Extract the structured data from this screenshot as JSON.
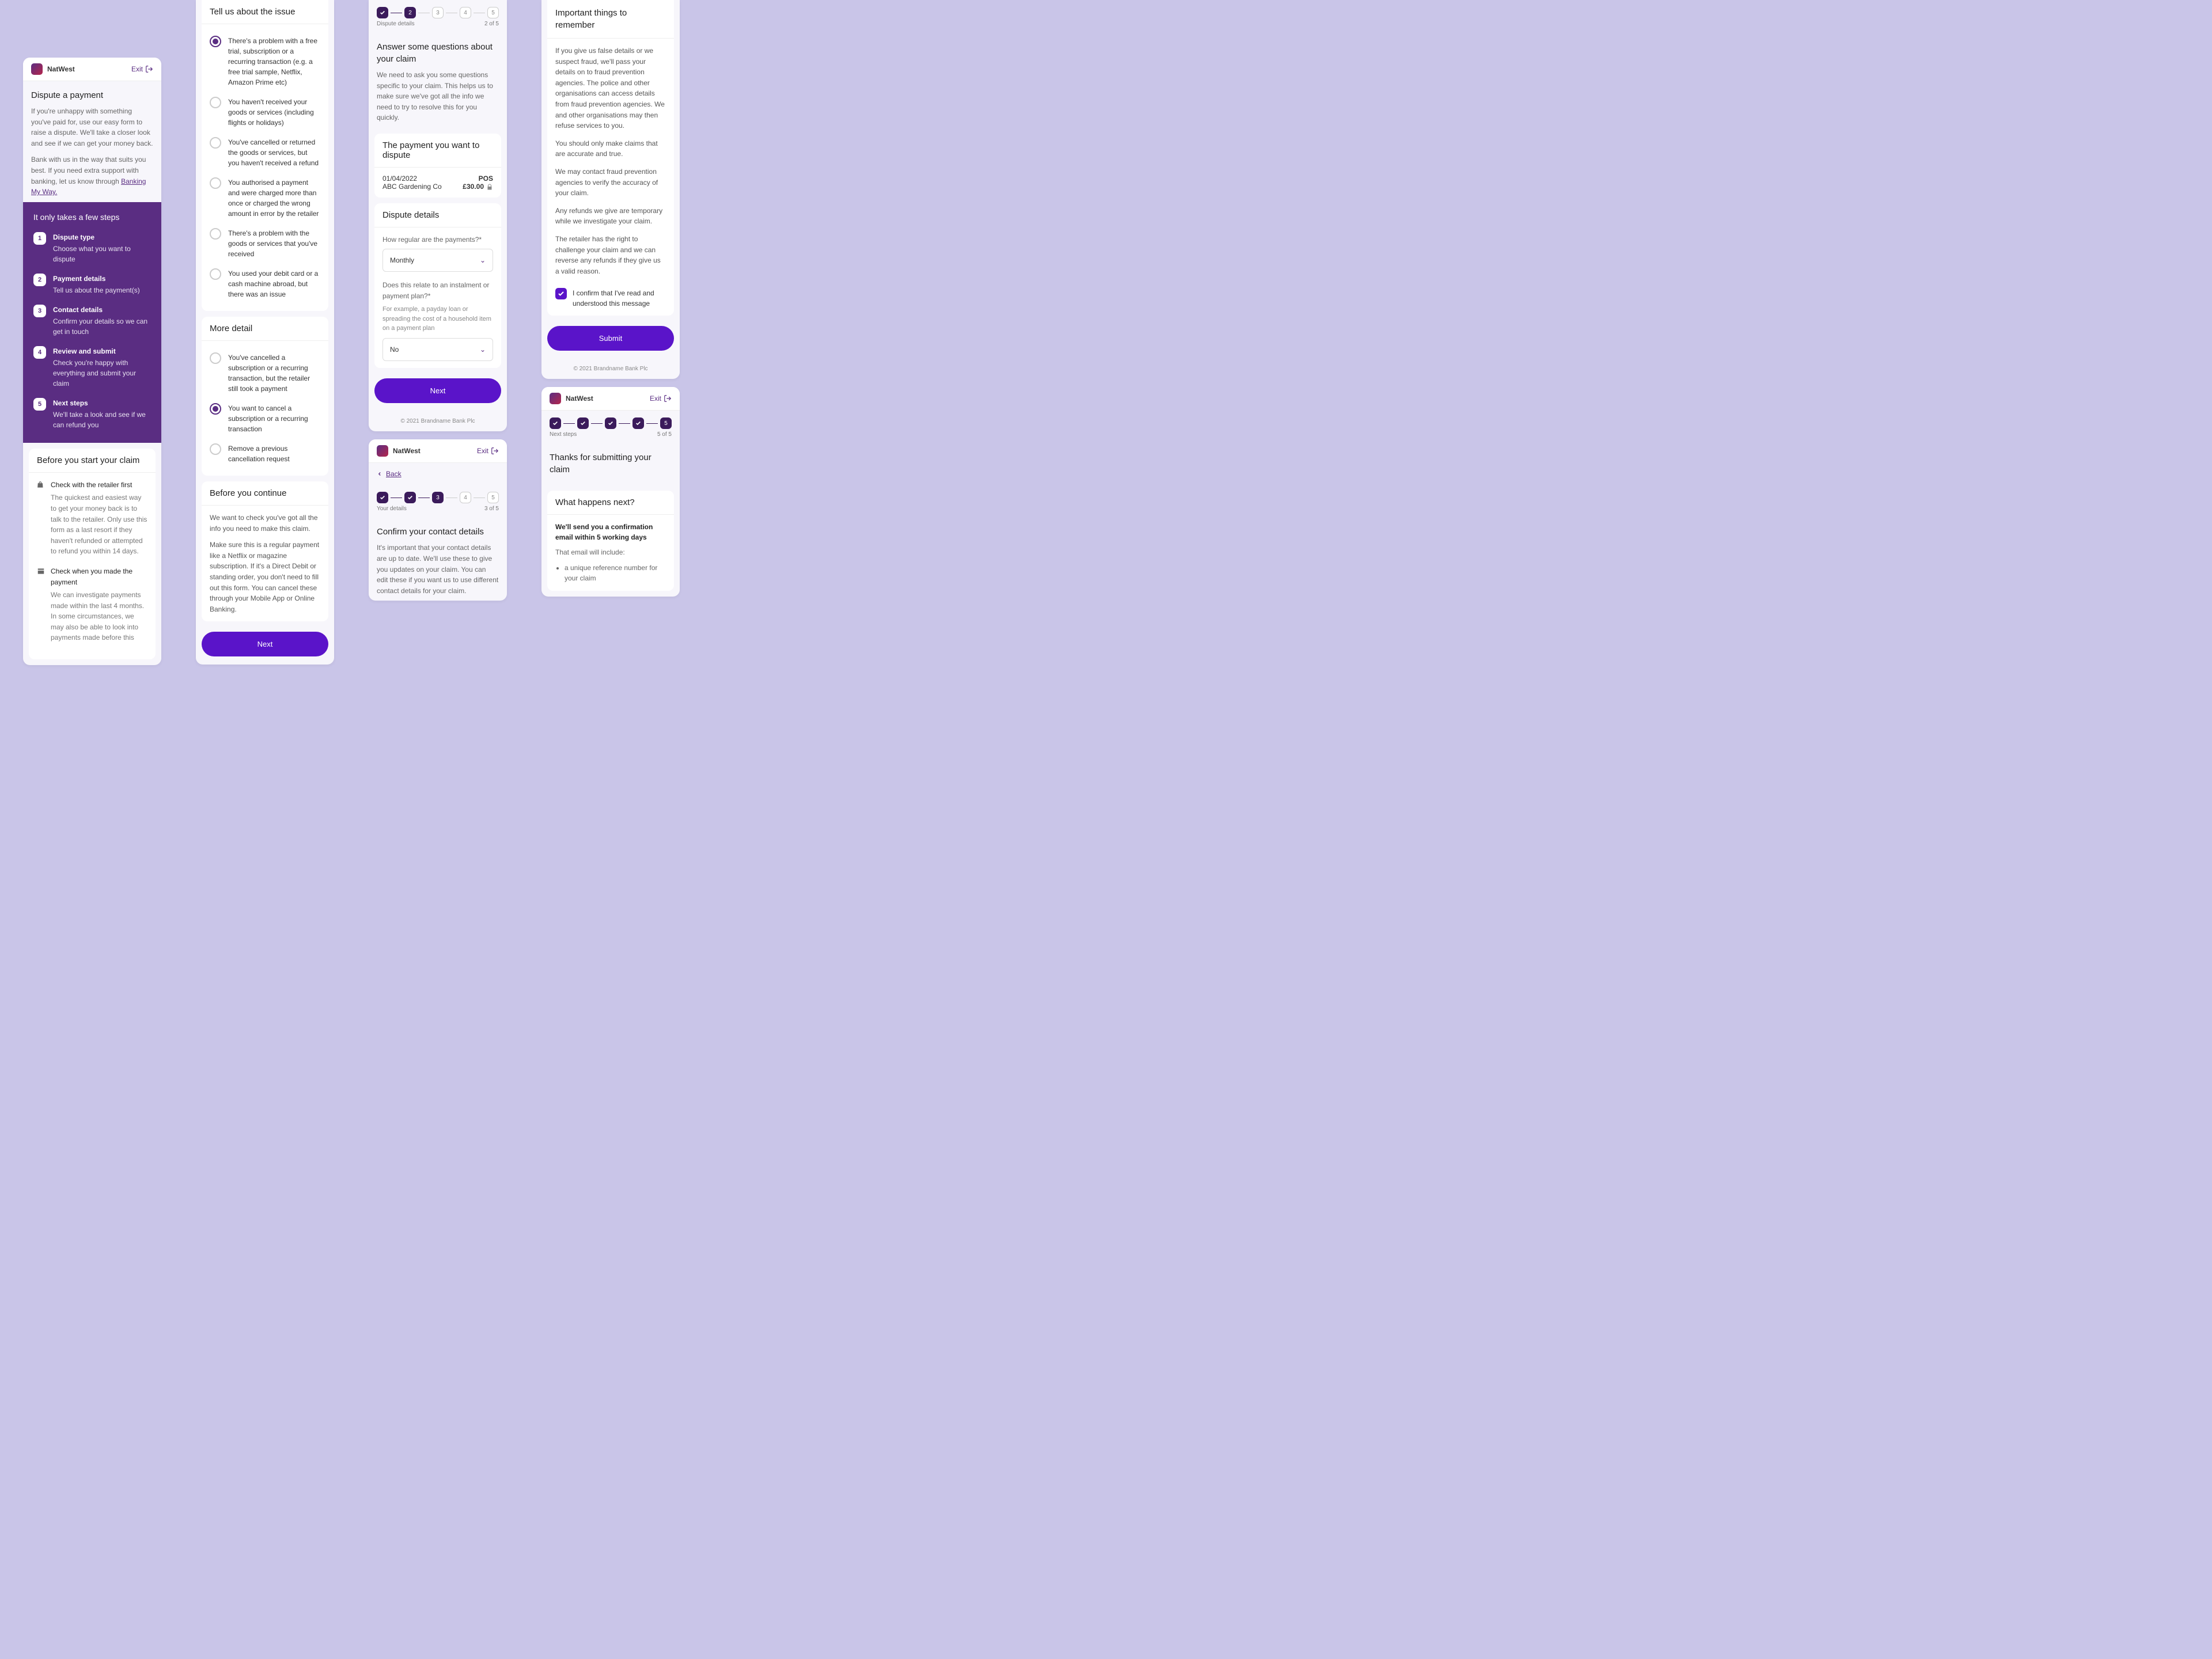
{
  "brand": "NatWest",
  "exit": "Exit",
  "footer": "© 2021 Brandname Bank Plc",
  "col1": {
    "title": "Dispute a payment",
    "p1": "If you're unhappy with something you've paid for, use our easy form to raise a dispute. We'll take a closer look and see if we can get your money back.",
    "p2a": "Bank with us in the way that suits you best. If you need extra support with banking, let us know through ",
    "p2link": "Banking My Way.",
    "stepsTitle": "It only takes a few steps",
    "steps": [
      {
        "n": "1",
        "t": "Dispute type",
        "d": "Choose what you want to dispute"
      },
      {
        "n": "2",
        "t": "Payment details",
        "d": "Tell us about the payment(s)"
      },
      {
        "n": "3",
        "t": "Contact details",
        "d": "Confirm your details so we can get in touch"
      },
      {
        "n": "4",
        "t": "Review and submit",
        "d": "Check you're happy with everything and submit your claim"
      },
      {
        "n": "5",
        "t": "Next steps",
        "d": "We'll take a look and see if we can refund you"
      }
    ],
    "beforeTitle": "Before you start your claim",
    "before": [
      {
        "t": "Check with the retailer first",
        "d": "The quickest and easiest way to get your money back is to talk to the retailer. Only use this form as a last resort if they haven't refunded or attempted to refund you within 14 days."
      },
      {
        "t": "Check when you made the payment",
        "d": "We can investigate payments made within the last 4 months. In some circumstances, we may also be able to look into payments made before this"
      }
    ]
  },
  "col2": {
    "issueTitle": "Tell us about the issue",
    "issues": [
      "There's a problem with a free trial, subscription or a recurring transaction (e.g. a free trial sample, Netflix, Amazon Prime etc)",
      "You haven't received your goods or services (including flights or holidays)",
      "You've cancelled or returned the goods or services, but you haven't received a refund",
      "You authorised a payment and were charged more than once or charged the wrong amount in error by the retailer",
      "There's a problem with the goods or services that you've received",
      "You used your debit card or a cash machine abroad, but there was an issue"
    ],
    "moreTitle": "More detail",
    "more": [
      "You've cancelled a subscription or a recurring transaction, but the retailer still took a payment",
      "You want to cancel a subscription or a recurring transaction",
      "Remove a previous cancellation request"
    ],
    "contTitle": "Before you continue",
    "cont1": "We want to check you've got all the info you need to make this claim.",
    "cont2": "Make sure this is a regular payment like a Netflix or magazine subscription. If it's a Direct Debit or standing order, you don't need to fill out this form. You can cancel these through your Mobile App or Online Banking.",
    "next": "Next"
  },
  "col3": {
    "stepLabel": "Dispute details",
    "stepCount": "2 of 5",
    "title": "Answer some questions about your claim",
    "desc": "We need to ask you some questions specific to your claim. This helps us to make sure we've got all the info we need to try to resolve this for you quickly.",
    "payTitle": "The payment you want to dispute",
    "payDate": "01/04/2022",
    "payMerch": "ABC Gardening Co",
    "payType": "POS",
    "payAmt": "£30.00",
    "ddTitle": "Dispute details",
    "q1": "How regular are the payments?*",
    "a1": "Monthly",
    "q2": "Does this relate to an instalment or payment plan?*",
    "q2hint": "For example, a payday loan or spreading the cost of a household item on a payment plan",
    "a2": "No",
    "next": "Next"
  },
  "col4": {
    "back": "Back",
    "stepLabel": "Your details",
    "stepCount": "3 of 5",
    "title": "Confirm your contact details",
    "desc": "It's important that your contact details are up to date. We'll use these to give you updates on your claim. You can edit these if you want us to use different contact details for your claim."
  },
  "col5a": {
    "title": "Important things to remember",
    "paras": [
      "If you give us false details or we suspect fraud, we'll pass your details on to fraud prevention agencies. The police and other organisations can access details from fraud prevention agencies. We and other organisations may then refuse services to you.",
      "You should only make claims that are accurate and true.",
      "We may contact fraud prevention agencies to verify the accuracy of your claim.",
      "Any refunds we give are temporary while we investigate your claim.",
      "The retailer has the right to challenge your claim and we can reverse any refunds if they give us a valid reason."
    ],
    "confirm": "I confirm that I've read and understood this message",
    "submit": "Submit"
  },
  "col5b": {
    "stepLabel": "Next steps",
    "stepCount": "5 of 5",
    "title": "Thanks for submitting your claim",
    "whnTitle": "What happens next?",
    "whn1": "We'll send you a confirmation email within 5 working days",
    "whn2": "That email will include:",
    "whn3": "a unique reference number for your claim"
  }
}
